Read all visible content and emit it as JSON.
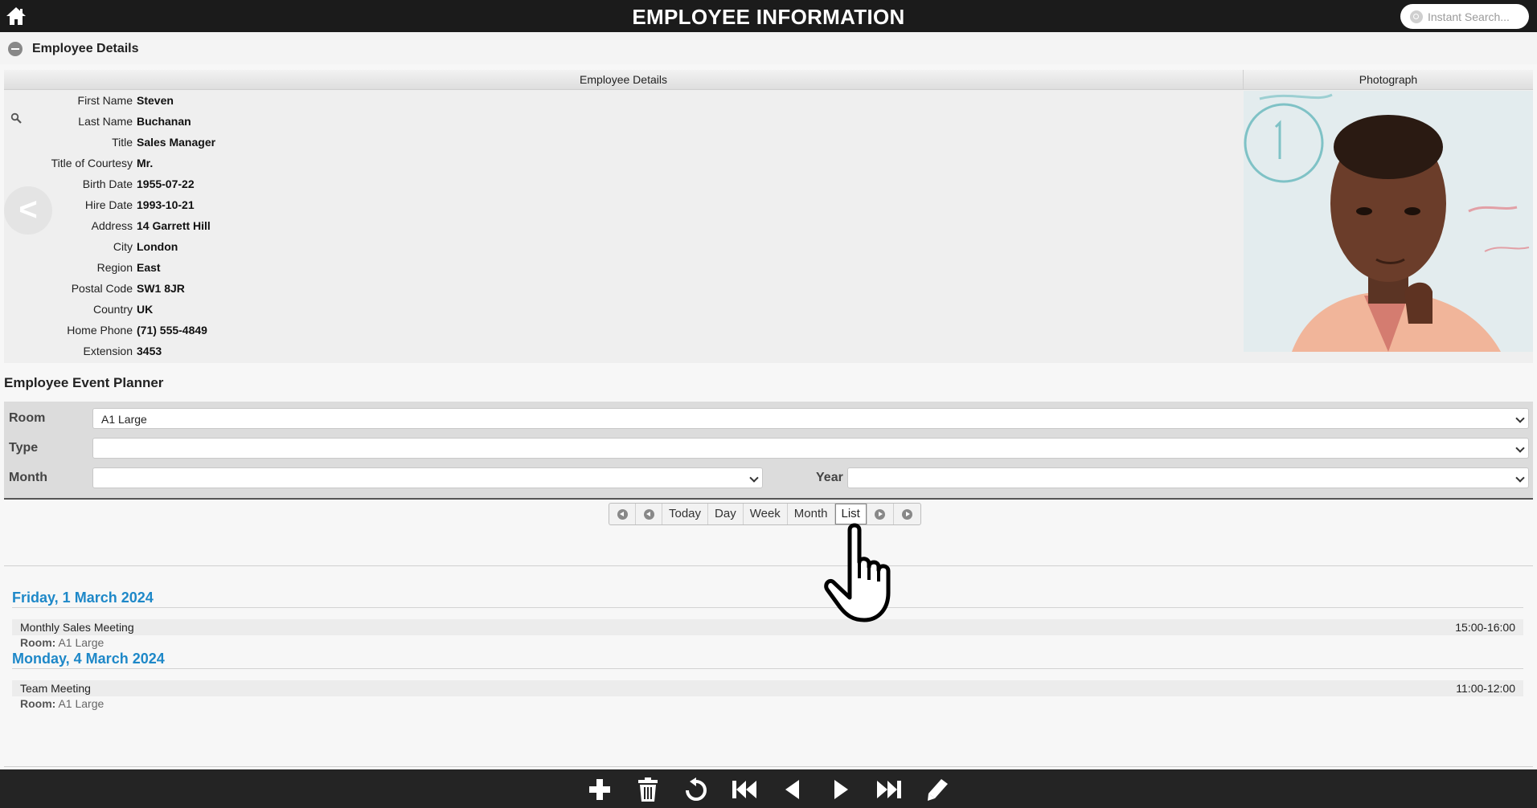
{
  "header": {
    "title": "EMPLOYEE INFORMATION",
    "search_placeholder": "Instant Search..."
  },
  "details_section": {
    "label": "Employee Details",
    "col_details": "Employee Details",
    "col_photo": "Photograph",
    "nav_prev": "<",
    "nav_next": ">",
    "fields": [
      {
        "label": "First Name",
        "value": "Steven"
      },
      {
        "label": "Last Name",
        "value": "Buchanan"
      },
      {
        "label": "Title",
        "value": "Sales Manager"
      },
      {
        "label": "Title of Courtesy",
        "value": "Mr."
      },
      {
        "label": "Birth Date",
        "value": "1955-07-22"
      },
      {
        "label": "Hire Date",
        "value": "1993-10-21"
      },
      {
        "label": "Address",
        "value": "14 Garrett Hill"
      },
      {
        "label": "City",
        "value": "London"
      },
      {
        "label": "Region",
        "value": "East"
      },
      {
        "label": "Postal Code",
        "value": "SW1 8JR"
      },
      {
        "label": "Country",
        "value": "UK"
      },
      {
        "label": "Home Phone",
        "value": "(71) 555-4849"
      },
      {
        "label": "Extension",
        "value": "3453"
      }
    ]
  },
  "planner": {
    "title": "Employee Event Planner",
    "room_label": "Room",
    "room_value": "A1 Large",
    "type_label": "Type",
    "type_value": "",
    "month_label": "Month",
    "month_value": "",
    "year_label": "Year",
    "year_value": "",
    "calendar_buttons": {
      "today": "Today",
      "day": "Day",
      "week": "Week",
      "month": "Month",
      "list": "List"
    },
    "active_view": "List",
    "days": [
      {
        "heading": "Friday, 1 March 2024",
        "events": [
          {
            "name": "Monthly Sales Meeting",
            "time": "15:00-16:00",
            "room_label": "Room:",
            "room": "A1 Large"
          }
        ]
      },
      {
        "heading": "Monday, 4 March 2024",
        "events": [
          {
            "name": "Team Meeting",
            "time": "11:00-12:00",
            "room_label": "Room:",
            "room": "A1 Large"
          }
        ]
      }
    ]
  },
  "bottom_toolbar": [
    "add-icon",
    "trash-icon",
    "undo-icon",
    "first-record-icon",
    "previous-icon",
    "next-icon",
    "last-record-icon",
    "edit-icon"
  ],
  "colors": {
    "header_bg": "#1b1b1b",
    "accent_blue": "#1e88c8",
    "toolbar_bg": "#242424"
  }
}
